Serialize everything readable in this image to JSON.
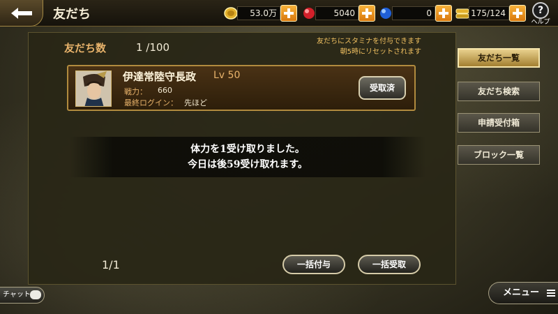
{
  "header": {
    "title": "友だち",
    "resources": [
      {
        "name": "gold",
        "icon": "coin-icon",
        "value": "53.0万"
      },
      {
        "name": "red-orb",
        "icon": "red-orb-icon",
        "value": "5040"
      },
      {
        "name": "blue-orb",
        "icon": "blue-orb-icon",
        "value": "0"
      },
      {
        "name": "capacity",
        "icon": "capacity-icon",
        "value": "175/124"
      }
    ],
    "help_label": "ヘルプ",
    "help_glyph": "?"
  },
  "friends": {
    "count_label": "友だち数",
    "count_value": "1 /100",
    "notice_lines": [
      "友だちにスタミナを付与できます",
      "朝5時にリセットされます"
    ],
    "list": [
      {
        "name": "伊達常陸守長政",
        "level": "Lv 50",
        "power_label": "戦力：",
        "power_value": "660",
        "login_label": "最終ログイン：",
        "login_value": "先ほど",
        "button_label": "受取済"
      }
    ]
  },
  "toast": {
    "line1": "体力を1受け取りました。",
    "line2": "今日は後59受け取れます。"
  },
  "footer": {
    "page": "1/1",
    "bulk_give_label": "一括付与",
    "bulk_receive_label": "一括受取"
  },
  "side_tabs": [
    {
      "label": "友だち一覧",
      "active": true
    },
    {
      "label": "友だち検索",
      "active": false
    },
    {
      "label": "申請受付箱",
      "active": false
    },
    {
      "label": "ブロック一覧",
      "active": false
    }
  ],
  "bottom": {
    "chat_label": "チャット",
    "menu_label": "メニュー"
  },
  "colors": {
    "accent_gold": "#e8b36b",
    "notice_yellow": "#f0c060",
    "plus_orange": "#f0a030"
  }
}
